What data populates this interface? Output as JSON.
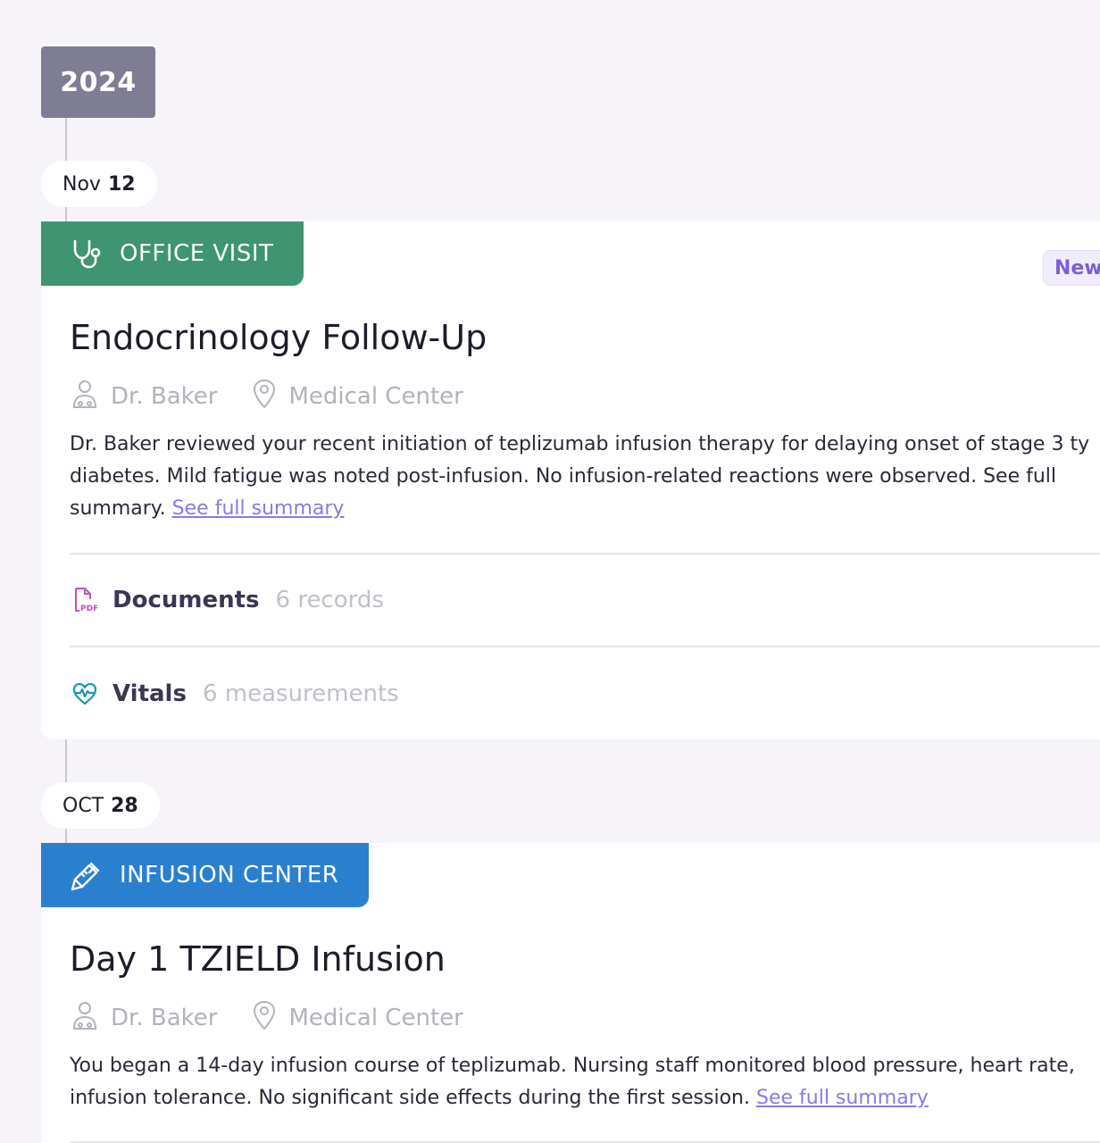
{
  "timeline": {
    "year": "2024",
    "entries": [
      {
        "date_month": "Nov",
        "date_day": "12",
        "type_label": "OFFICE VISIT",
        "type_icon": "stethoscope-icon",
        "type_color": "#3f9472",
        "badge": "New",
        "title": "Endocrinology Follow-Up",
        "provider": "Dr. Baker",
        "location": "Medical Center",
        "summary_line1": "Dr. Baker reviewed your recent initiation of teplizumab infusion therapy for delaying onset of stage 3 ty",
        "summary_line2": "diabetes. Mild fatigue was noted post-infusion. No infusion-related reactions were observed. See full",
        "summary_line3": "summary.",
        "summary_link": "See full summary",
        "documents_label": "Documents",
        "documents_count": "6 records",
        "vitals_label": "Vitals",
        "vitals_count": "6 measurements"
      },
      {
        "date_month": "OCT",
        "date_day": "28",
        "type_label": "INFUSION CENTER",
        "type_icon": "syringe-icon",
        "type_color": "#2b7fcf",
        "title": "Day 1 TZIELD Infusion",
        "provider": "Dr. Baker",
        "location": "Medical Center",
        "summary_line1": "You began a 14-day infusion course of teplizumab. Nursing staff monitored blood pressure, heart rate,",
        "summary_line2": "infusion tolerance. No significant side effects during the first session.",
        "summary_link": "See full summary"
      }
    ]
  }
}
